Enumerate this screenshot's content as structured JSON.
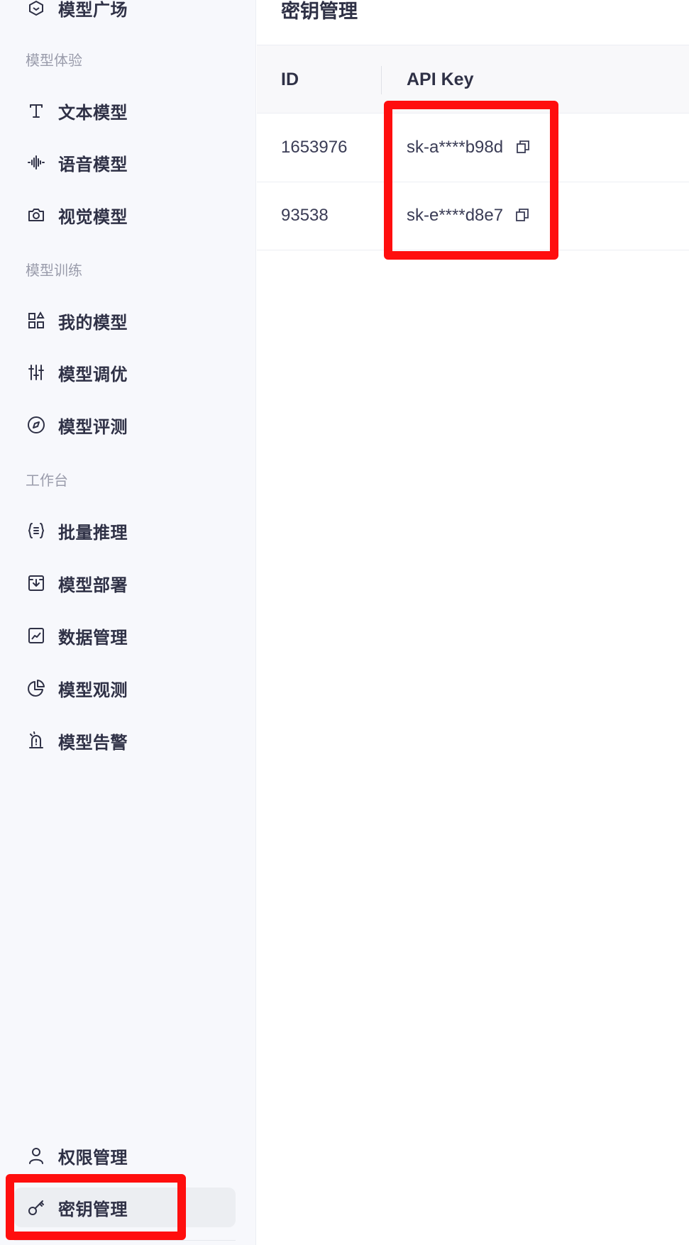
{
  "sidebar": {
    "items": [
      {
        "label": "模型广场",
        "icon": "model-plaza-icon"
      },
      {
        "label": "文本模型",
        "icon": "text-icon"
      },
      {
        "label": "语音模型",
        "icon": "voice-wave-icon"
      },
      {
        "label": "视觉模型",
        "icon": "camera-icon"
      },
      {
        "label": "我的模型",
        "icon": "apps-grid-icon"
      },
      {
        "label": "模型调优",
        "icon": "sliders-icon"
      },
      {
        "label": "模型评测",
        "icon": "compass-icon"
      },
      {
        "label": "批量推理",
        "icon": "braces-list-icon"
      },
      {
        "label": "模型部署",
        "icon": "download-box-icon"
      },
      {
        "label": "数据管理",
        "icon": "line-chart-icon"
      },
      {
        "label": "模型观测",
        "icon": "pie-chart-icon"
      },
      {
        "label": "模型告警",
        "icon": "alarm-icon"
      },
      {
        "label": "权限管理",
        "icon": "user-icon"
      },
      {
        "label": "密钥管理",
        "icon": "key-icon"
      }
    ],
    "sections": {
      "experience": "模型体验",
      "training": "模型训练",
      "workbench": "工作台"
    }
  },
  "main": {
    "title": "密钥管理",
    "table": {
      "columns": [
        "ID",
        "API Key"
      ],
      "rows": [
        {
          "id": "1653976",
          "api_key": "sk-a****b98d"
        },
        {
          "id": "93538",
          "api_key": "sk-e****d8e7"
        }
      ]
    }
  },
  "colors": {
    "highlight": "#ff0e0e",
    "sidebar_bg": "#f7f8fc",
    "text": "#2f3146"
  }
}
